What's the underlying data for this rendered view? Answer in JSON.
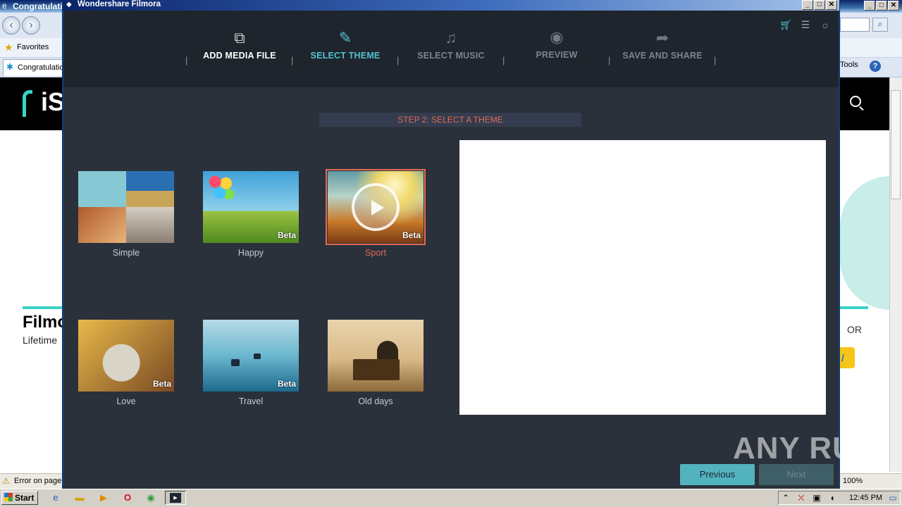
{
  "browser": {
    "title": "Congratulati",
    "favorites_label": "Favorites",
    "tab_label": "Congratulatio",
    "tools_label": "Tools",
    "status_text": "Error on page",
    "zoom": "100%",
    "web_title": "Filmo",
    "web_subtitle": "Lifetime",
    "web_or": "OR",
    "web_logo": "iS"
  },
  "taskbar": {
    "start_label": "Start",
    "clock": "12:45 PM"
  },
  "filmora": {
    "window_title": "Wondershare Filmora",
    "steps": [
      {
        "label": "ADD MEDIA FILE",
        "state": "done",
        "icon": "media-icon"
      },
      {
        "label": "SELECT THEME",
        "state": "active",
        "icon": "theme-icon"
      },
      {
        "label": "SELECT MUSIC",
        "state": "inactive",
        "icon": "music-icon"
      },
      {
        "label": "PREVIEW",
        "state": "inactive",
        "icon": "eye-icon"
      },
      {
        "label": "SAVE AND SHARE",
        "state": "inactive",
        "icon": "share-icon"
      }
    ],
    "separator": "|",
    "step_banner": "STEP 2: SELECT A THEME",
    "themes": [
      {
        "name": "Simple",
        "badge": ""
      },
      {
        "name": "Happy",
        "badge": "Beta"
      },
      {
        "name": "Sport",
        "badge": "Beta",
        "selected": true
      },
      {
        "name": "Love",
        "badge": "Beta"
      },
      {
        "name": "Travel",
        "badge": "Beta"
      },
      {
        "name": "Old days",
        "badge": ""
      }
    ],
    "previous_label": "Previous",
    "next_label": "Next",
    "colors": {
      "accent": "#52c3d1",
      "selected": "#e26a55",
      "panel": "#2a313a",
      "header": "#1e252c"
    }
  },
  "watermark": "ANY RUN"
}
